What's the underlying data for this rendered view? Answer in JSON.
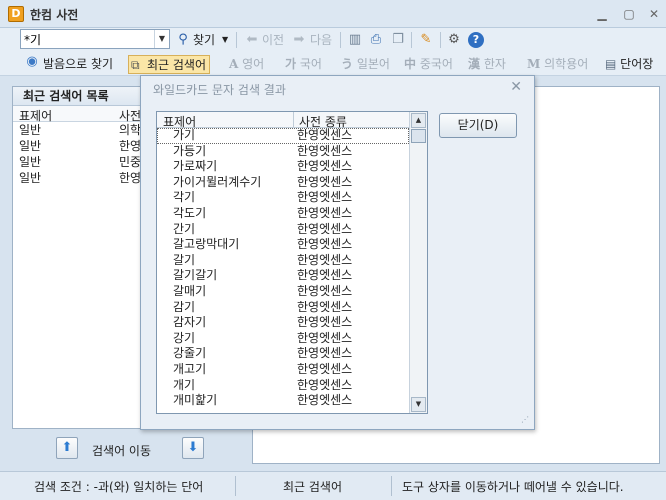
{
  "window": {
    "title": "한컴 사전",
    "app_icon": "D",
    "min_icon": "minimize-icon",
    "max_icon": "maximize-icon",
    "close_icon": "close-icon"
  },
  "toolbar1": {
    "search_value": "*기",
    "find_label": "찾기",
    "prev_label": "이전",
    "next_label": "다음"
  },
  "toolbar2": {
    "pronounce_search": "발음으로 찾기",
    "recent_search": "최근 검색어",
    "tabs": [
      "영어",
      "국어",
      "일본어",
      "중국어",
      "한자",
      "의학용어",
      "단어장"
    ]
  },
  "left_panel": {
    "title": "최근 검색어 목록",
    "col_headword": "표제어",
    "col_dict": "사전",
    "rows": [
      {
        "type": "일반",
        "dict": "의학"
      },
      {
        "type": "일반",
        "dict": "한영"
      },
      {
        "type": "일반",
        "dict": "민중"
      },
      {
        "type": "일반",
        "dict": "한영"
      }
    ],
    "move_label": "검색어 이동"
  },
  "dialog": {
    "title": "와일드카드 문자 검색 결과",
    "col_headword": "표제어",
    "col_dict": "사전 종류",
    "close_button": "닫기(D)",
    "rows": [
      {
        "word": "가기",
        "dict": "한영엣센스"
      },
      {
        "word": "가등기",
        "dict": "한영엣센스"
      },
      {
        "word": "가로짜기",
        "dict": "한영엣센스"
      },
      {
        "word": "가이거뮐러계수기",
        "dict": "한영엣센스"
      },
      {
        "word": "각기",
        "dict": "한영엣센스"
      },
      {
        "word": "각도기",
        "dict": "한영엣센스"
      },
      {
        "word": "간기",
        "dict": "한영엣센스"
      },
      {
        "word": "갈고랑막대기",
        "dict": "한영엣센스"
      },
      {
        "word": "갈기",
        "dict": "한영엣센스"
      },
      {
        "word": "갈기갈기",
        "dict": "한영엣센스"
      },
      {
        "word": "갈매기",
        "dict": "한영엣센스"
      },
      {
        "word": "감기",
        "dict": "한영엣센스"
      },
      {
        "word": "감자기",
        "dict": "한영엣센스"
      },
      {
        "word": "강기",
        "dict": "한영엣센스"
      },
      {
        "word": "강줄기",
        "dict": "한영엣센스"
      },
      {
        "word": "개고기",
        "dict": "한영엣센스"
      },
      {
        "word": "개기",
        "dict": "한영엣센스"
      },
      {
        "word": "개미핥기",
        "dict": "한영엣센스"
      }
    ]
  },
  "statusbar": {
    "condition": "검색 조건 : -과(와) 일치하는 단어",
    "mode": "최근 검색어",
    "hint": "도구 상자를 이동하거나 떼어낼 수 있습니다."
  }
}
